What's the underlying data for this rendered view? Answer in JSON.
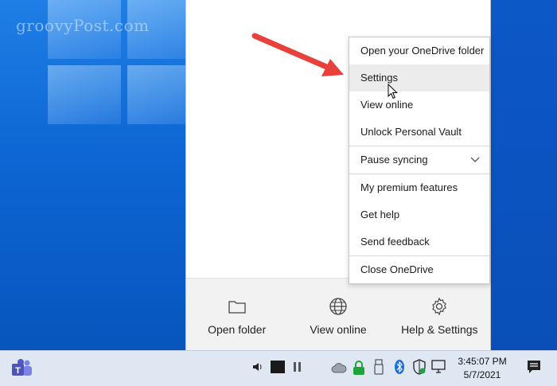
{
  "watermark": "groovyPost.com",
  "context_menu": {
    "items": [
      {
        "label": "Open your OneDrive folder"
      },
      {
        "label": "Settings"
      },
      {
        "label": "View online"
      },
      {
        "label": "Unlock Personal Vault"
      },
      {
        "label": "Pause syncing"
      },
      {
        "label": "My premium features"
      },
      {
        "label": "Get help"
      },
      {
        "label": "Send feedback"
      },
      {
        "label": "Close OneDrive"
      }
    ]
  },
  "flyout_footer": {
    "open_folder": "Open folder",
    "view_online": "View online",
    "help_settings": "Help & Settings"
  },
  "taskbar": {
    "time": "3:45:07 PM",
    "date": "5/7/2021"
  },
  "icons": {
    "teams": "teams-icon",
    "onedrive": "onedrive-cloud-icon",
    "arrow_color": "#e8403a"
  }
}
